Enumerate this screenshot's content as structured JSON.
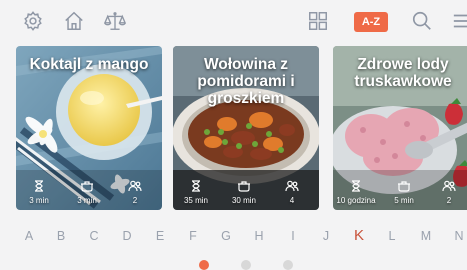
{
  "toolbar": {
    "icons": [
      "gear-icon",
      "home-icon",
      "scales-icon",
      "grid-view-icon",
      "az-sort-icon",
      "search-icon",
      "menu-icon"
    ],
    "sort_label": "A-Z",
    "icon_color": "#8f97a5",
    "accent_color": "#ef6a47"
  },
  "recipes": [
    {
      "title": "Koktajl z mango",
      "stats": [
        {
          "icon": "hourglass-icon",
          "value": "3 min"
        },
        {
          "icon": "pot-icon",
          "value": "3 min"
        },
        {
          "icon": "people-icon",
          "value": "2"
        }
      ]
    },
    {
      "title": "Wołowina z pomidorami i groszkiem",
      "stats": [
        {
          "icon": "hourglass-icon",
          "value": "35 min"
        },
        {
          "icon": "pot-icon",
          "value": "30 min"
        },
        {
          "icon": "people-icon",
          "value": "4"
        }
      ]
    },
    {
      "title": "Zdrowe lody truskawkowe",
      "stats": [
        {
          "icon": "hourglass-icon",
          "value": "10 godzina"
        },
        {
          "icon": "pot-icon",
          "value": "5 min"
        },
        {
          "icon": "people-icon",
          "value": "2"
        }
      ]
    }
  ],
  "alphabet": {
    "letters": [
      "A",
      "B",
      "C",
      "D",
      "E",
      "F",
      "G",
      "H",
      "I",
      "J",
      "K",
      "L",
      "M",
      "N"
    ],
    "selected": "K",
    "selected_color": "#c8533b"
  },
  "pagination": {
    "active_page": 1
  }
}
